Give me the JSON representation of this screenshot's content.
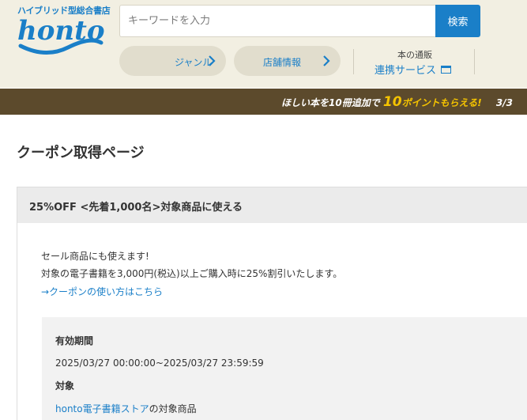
{
  "header": {
    "tagline": "ハイブリッド型総合書店",
    "logo_text": "honto",
    "search": {
      "placeholder": "キーワードを入力",
      "button_label": "検索"
    },
    "nav": {
      "genre_label": "ジャンル",
      "store_label": "店舗情報",
      "service_top": "本の通販",
      "service_main": "連携サービス"
    }
  },
  "promo": {
    "prefix": "ほしい本を10冊追加で",
    "number": "10",
    "suffix": "ポイントもらえる!",
    "date": "3/3"
  },
  "page": {
    "title": "クーポン取得ページ"
  },
  "coupon": {
    "title": "25%OFF <先着1,000名>対象商品に使える",
    "desc_line1": "セール商品にも使えます!",
    "desc_line2": "対象の電子書籍を3,000円(税込)以上ご購入時に25%割引いたします。",
    "howto_link": "→クーポンの使い方はこちら",
    "validity_label": "有効期間",
    "validity_value": "2025/03/27 00:00:00~2025/03/27 23:59:59",
    "target_label": "対象",
    "target_link": "honto電子書籍ストア",
    "target_suffix": "の対象商品"
  },
  "colors": {
    "brand_blue": "#1a7fc8",
    "header_bg": "#f2efe2",
    "promo_bg": "#5c4a2c",
    "promo_accent": "#f5c400"
  },
  "icons": {
    "genre_chevron": "chevron-right-icon",
    "store_chevron": "chevron-right-icon",
    "service_window": "window-icon"
  }
}
